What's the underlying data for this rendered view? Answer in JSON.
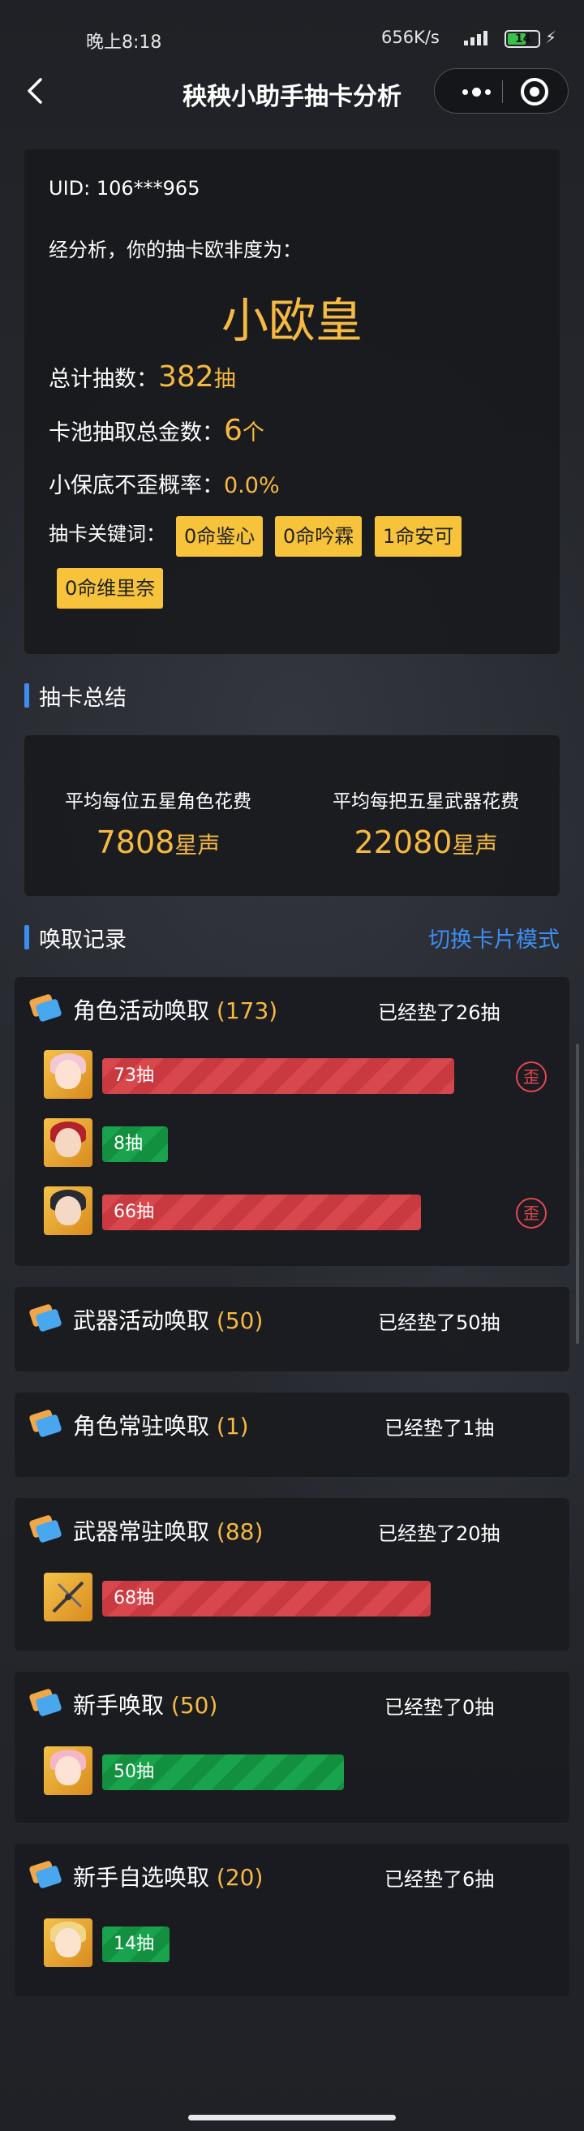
{
  "status_bar": {
    "time": "晚上8:18",
    "network": "656K/s",
    "battery": "14"
  },
  "nav": {
    "title": "秧秧小助手抽卡分析"
  },
  "summary": {
    "uid_label": "UID: ",
    "uid_value": "106***965",
    "analysis_text": "经分析，你的抽卡欧非度为：",
    "rank": "小欧皇",
    "total_label": "总计抽数：",
    "total_value": "382",
    "total_unit": "抽",
    "gold_label": "卡池抽取总金数：",
    "gold_value": "6",
    "gold_unit": "个",
    "nowai_label": "小保底不歪概率：",
    "nowai_value": "0.0%",
    "keywords_label": "抽卡关键词：",
    "keywords": [
      "0命鉴心",
      "0命吟霖",
      "1命安可",
      "0命维里奈"
    ]
  },
  "sections": {
    "summary_title": "抽卡总结",
    "records_title": "唤取记录",
    "switch_mode": "切换卡片模式"
  },
  "averages": {
    "char_label": "平均每位五星角色花费",
    "char_value": "7808",
    "weapon_label": "平均每把五星武器花费",
    "weapon_value": "22080",
    "unit": "星声"
  },
  "pools": [
    {
      "name": "角色活动唤取",
      "count": "(173)",
      "pity": "已经垫了26抽",
      "entries": [
        {
          "label": "73抽",
          "pulls": 73,
          "color": "red",
          "wai": "歪"
        },
        {
          "label": "8抽",
          "pulls": 8,
          "color": "green"
        },
        {
          "label": "66抽",
          "pulls": 66,
          "color": "red",
          "wai": "歪"
        }
      ]
    },
    {
      "name": "武器活动唤取",
      "count": "(50)",
      "pity": "已经垫了50抽",
      "entries": []
    },
    {
      "name": "角色常驻唤取",
      "count": "(1)",
      "pity": "已经垫了1抽",
      "entries": []
    },
    {
      "name": "武器常驻唤取",
      "count": "(88)",
      "pity": "已经垫了20抽",
      "entries": [
        {
          "label": "68抽",
          "pulls": 68,
          "color": "red"
        }
      ]
    },
    {
      "name": "新手唤取",
      "count": "(50)",
      "pity": "已经垫了0抽",
      "entries": [
        {
          "label": "50抽",
          "pulls": 50,
          "color": "green"
        }
      ]
    },
    {
      "name": "新手自选唤取",
      "count": "(20)",
      "pity": "已经垫了6抽",
      "entries": [
        {
          "label": "14抽",
          "pulls": 14,
          "color": "green"
        }
      ]
    }
  ],
  "colors": {
    "accent_gold": "#f6b941",
    "accent_blue": "#3d8cf0",
    "bar_red": "#d8474c",
    "bar_green": "#18a34c"
  }
}
